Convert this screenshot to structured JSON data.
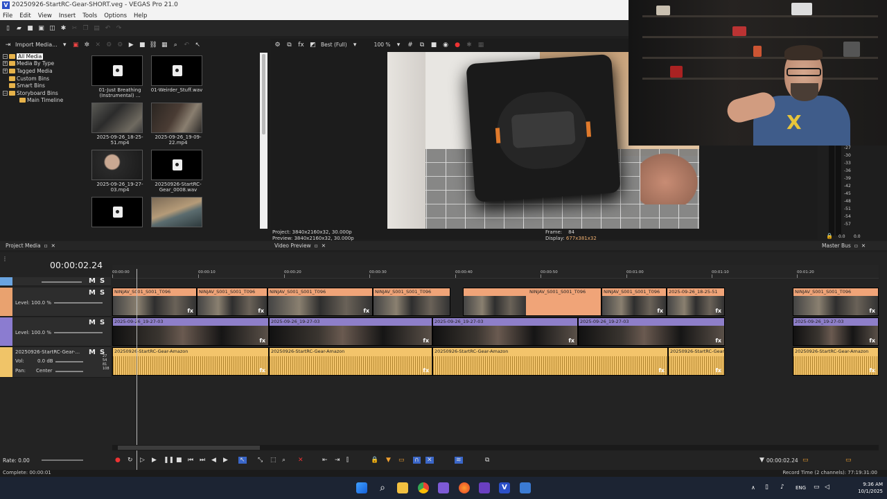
{
  "window": {
    "title": "20250926-StartRC-Gear-SHORT.veg - VEGAS Pro 21.0",
    "logo": "V"
  },
  "menu": [
    "File",
    "Edit",
    "View",
    "Insert",
    "Tools",
    "Options",
    "Help"
  ],
  "explorer": {
    "import_label": "Import Media...",
    "tree": [
      {
        "label": "All Media",
        "selected": true
      },
      {
        "label": "Media By Type"
      },
      {
        "label": "Tagged Media"
      },
      {
        "label": "Custom Bins"
      },
      {
        "label": "Smart Bins"
      },
      {
        "label": "Storyboard Bins"
      },
      {
        "label": "Main Timeline"
      }
    ],
    "media": [
      {
        "name": "01-Just Breathing (Instrumental) ...",
        "type": "audio"
      },
      {
        "name": "01-Weirder_Stuff.wav",
        "type": "audio"
      },
      {
        "name": "2025-09-26_18-25-51.mp4",
        "type": "video"
      },
      {
        "name": "2025-09-26_19-09-22.mp4",
        "type": "video"
      },
      {
        "name": "2025-09-26_19-27-03.mp4",
        "type": "video"
      },
      {
        "name": "20250926-StartRC-Gear_0008.wav",
        "type": "audio"
      }
    ],
    "tab": "Project Media"
  },
  "preview": {
    "quality": "Best (Full)",
    "zoom": "100 %",
    "project_label": "Project:",
    "project": "3840x2160x32, 30.000p",
    "preview_label": "Preview:",
    "preview": "3840x2160x32, 30.000p",
    "frame_label": "Frame:",
    "frame": "84",
    "display_label": "Display:",
    "display": "677x381x32",
    "tab": "Video Preview"
  },
  "masterbus": {
    "tab": "Master Bus",
    "db": [
      "-27",
      "-30",
      "-33",
      "-36",
      "-39",
      "-42",
      "-45",
      "-48",
      "-51",
      "-54",
      "-57"
    ],
    "left": "0.0",
    "right": "0.0"
  },
  "timeline": {
    "timecode": "00:00:02.24",
    "ruler": [
      "00:00:00",
      "00:00:10",
      "00:00:20",
      "00:00:30",
      "00:00:40",
      "00:00:50",
      "00:01:00",
      "00:01:10",
      "00:01:20"
    ],
    "tracks": [
      {
        "level": "Level: 100.0 %",
        "ms": "MS"
      },
      {
        "level": "Level: 100.0 %",
        "ms": "MS"
      },
      {
        "name": "20250926-StartRC-Gear-...",
        "vol_label": "Vol:",
        "vol": "0.0 dB",
        "pan_label": "Pan:",
        "pan": "Center",
        "ms": "MS",
        "meter": [
          "27",
          "54",
          "81",
          "108"
        ]
      }
    ],
    "clips_v1": [
      "NINJAV_S001_S001_T096",
      "NINJAV_S001_S001_T096",
      "NINJAV_S001_S001_T096",
      "NINJAV_S001_S001_T096",
      "2025-09-26_18-25-51"
    ],
    "clips_v2": [
      "2025-09-26_19-27-03",
      "2025-09-26_19-27-03",
      "2025-09-26_19-27-03"
    ],
    "clips_a1": [
      "20250926-StartRC-Gear-Amazon",
      "20250926-StartRC-Gear-Amazon",
      "20250926-StartRC-Gear-Amazon",
      "20250926-StartRC-Gear",
      "20250926-StartRC-Gear-Amazon"
    ],
    "fx": "fx",
    "rate": "Rate: 0.00",
    "cursor_time": "00:00:02.24"
  },
  "status": {
    "left": "Complete: 00:00:01",
    "right": "Record Time (2 channels): 77:19:31:00"
  },
  "taskbar": {
    "lang": "ENG",
    "time": "9:36 AM",
    "date": "10/1/2025"
  }
}
